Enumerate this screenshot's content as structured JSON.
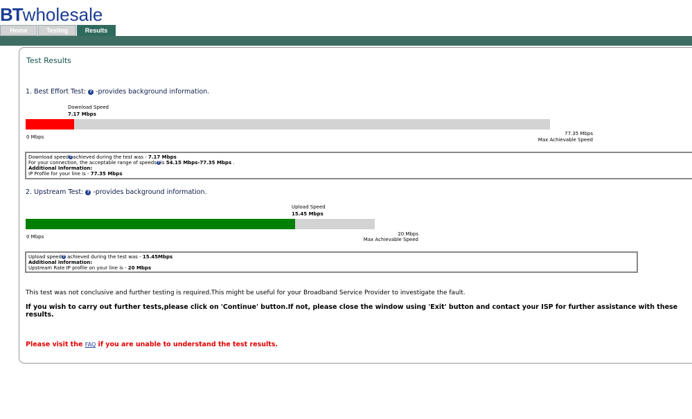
{
  "logo": {
    "bt": "BT",
    "wholesale": "wholesale"
  },
  "tabs": [
    {
      "label": "Home"
    },
    {
      "label": "Testing"
    },
    {
      "label": "Results"
    }
  ],
  "page_title": "Test Results",
  "best_effort": {
    "heading": "1. Best Effort Test:",
    "help_icon": "question-icon",
    "suffix": "-provides background information.",
    "marker_label": "Download Speed",
    "marker_value": "7.17 Mbps",
    "min_label": "0 Mbps",
    "max_value": "77.35 Mbps",
    "max_label": "Max Achievable Speed",
    "fraction": 0.0927,
    "fill_color": "#ff0000",
    "info": {
      "line1_pre": "Download speed",
      "line1_mid": "achieved during the test was - ",
      "line1_val": "7.17 Mbps",
      "line2_pre": "For your connection, the acceptable range of speeds",
      "line2_mid": "is ",
      "line2_val": "54.15 Mbps-77.35 Mbps",
      "line2_end": " .",
      "line3": "Additional Information:",
      "line4_pre": "IP Profile for your line is - ",
      "line4_val": "77.35 Mbps"
    }
  },
  "upstream": {
    "heading": "2. Upstream Test:",
    "help_icon": "question-icon",
    "suffix": "-provides background information.",
    "marker_label": "Upload Speed",
    "marker_value": "15.45 Mbps",
    "min_label": "0 Mbps",
    "max_value": "20 Mbps",
    "max_label": "Max Achievable Speed",
    "fraction": 0.7725,
    "fill_color": "#008000",
    "info": {
      "line1_pre": "Upload speed",
      "line1_mid": " achieved during the test was - ",
      "line1_val": "15.45Mbps",
      "line2": "Additional Information:",
      "line3_pre": "Upstream Rate IP profile on your line is - ",
      "line3_val": "20 Mbps"
    }
  },
  "messages": {
    "inconclusive": "This test was not conclusive and further testing is required.This might be useful for your Broadband Service Provider to investigate the fault.",
    "instructions": "If you wish to carry out further tests,please click on 'Continue' button.If not, please close the window using 'Exit' button and contact your ISP for further assistance with these results.",
    "faq_pre": "Please visit the ",
    "faq_link": "FAQ",
    "faq_post": " if you are unable to understand the test results."
  }
}
